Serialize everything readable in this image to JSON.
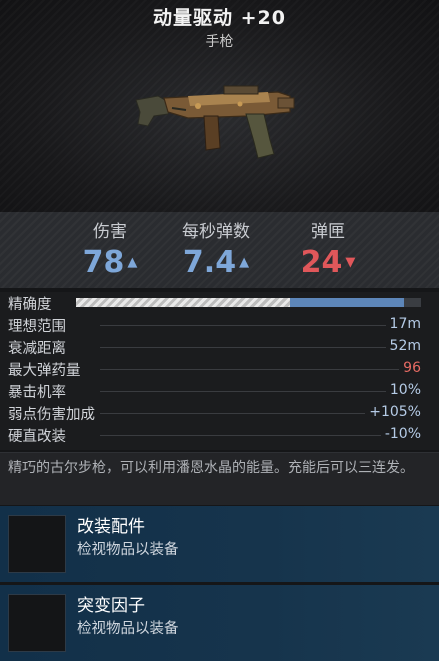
{
  "weapon": {
    "name": "动量驱动 +20",
    "type": "手枪"
  },
  "stats": [
    {
      "label": "伤害",
      "value": "78",
      "trend": "up",
      "color": "#7ea7d9"
    },
    {
      "label": "每秒弹数",
      "value": "7.4",
      "trend": "up",
      "color": "#7ea7d9"
    },
    {
      "label": "弹匣",
      "value": "24",
      "trend": "down",
      "color": "#e0575a"
    }
  ],
  "accuracy": {
    "label": "精确度",
    "base_fraction": 0.62,
    "total_fraction": 0.95
  },
  "attributes": [
    {
      "label": "理想范围",
      "value": "17m",
      "negative": false
    },
    {
      "label": "衰减距离",
      "value": "52m",
      "negative": false
    },
    {
      "label": "最大弹药量",
      "value": "96",
      "negative": true
    },
    {
      "label": "暴击机率",
      "value": "10%",
      "negative": false
    },
    {
      "label": "弱点伤害加成",
      "value": "+105%",
      "negative": false
    },
    {
      "label": "硬直改装",
      "value": "-10%",
      "negative": false
    }
  ],
  "description": "精巧的古尔步枪，可以利用潘恩水晶的能量。充能后可以三连发。",
  "slots": [
    {
      "name": "改装配件",
      "hint": "检视物品以装备"
    },
    {
      "name": "突变因子",
      "hint": "检视物品以装备"
    }
  ],
  "colors": {
    "positive": "#7ea7d9",
    "negative": "#e0575a",
    "slot_bg": "#16344c"
  },
  "icons": {
    "weapon_image": "pistol-weapon-icon",
    "up": "arrow-up-icon",
    "down": "arrow-down-icon"
  }
}
